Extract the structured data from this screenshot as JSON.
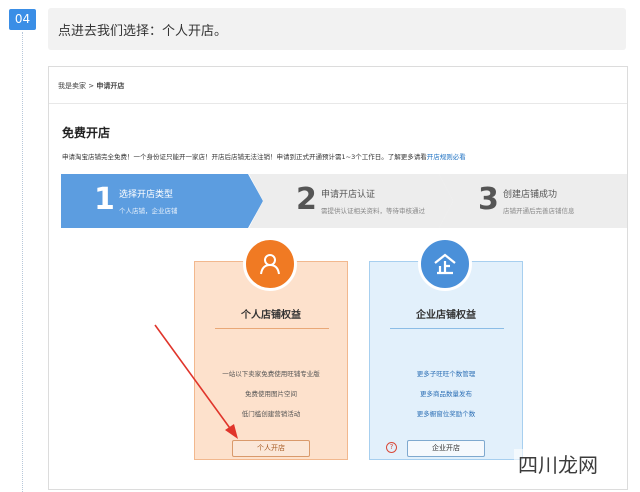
{
  "step": {
    "badge": "04",
    "instruction": "点进去我们选择：个人开店。"
  },
  "breadcrumb": {
    "root": "我是卖家",
    "separator": ">",
    "current": "申请开店"
  },
  "page": {
    "title": "免费开店",
    "notice": "申请淘宝店铺完全免费！一个身份证只能开一家店！开店后店铺无法注销！申请到正式开通预计需1~3个工作日。了解更多请看",
    "notice_link": "开店规则必看"
  },
  "progress": [
    {
      "num": "1",
      "title": "选择开店类型",
      "sub": "个人店铺，企业店铺",
      "active": true
    },
    {
      "num": "2",
      "title": "申请开店认证",
      "sub": "需提供认证相关资料，等待审核通过",
      "active": false
    },
    {
      "num": "3",
      "title": "创建店铺成功",
      "sub": "店铺开通后完善店铺信息",
      "active": false
    }
  ],
  "cards": {
    "personal": {
      "icon": "person-icon",
      "title": "个人店铺权益",
      "benefits": [
        "一站以下卖家免费使用旺铺专业版",
        "免费使用图片空间",
        "低门槛创建营销活动"
      ],
      "button": "个人开店"
    },
    "enterprise": {
      "icon": "enterprise-icon",
      "title": "企业店铺权益",
      "benefits": [
        "更多子旺旺个数管理",
        "更多商品数量发布",
        "更多橱窗位奖励个数"
      ],
      "button": "企业开店",
      "help": "?"
    }
  },
  "watermark": "四川龙网",
  "colors": {
    "badge": "#3a8ee6",
    "active_step": "#5c9de0",
    "personal_accent": "#f07a23",
    "enterprise_accent": "#4a90d9",
    "arrow": "#e0352b"
  }
}
